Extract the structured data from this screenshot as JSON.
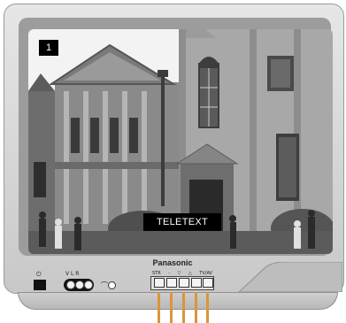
{
  "screen": {
    "channel_number": "1",
    "overlay_text": "TELETEXT"
  },
  "tv": {
    "brand": "Panasonic",
    "av_label": "V   L   R",
    "controls_labels": [
      "STR",
      "-",
      "▽",
      "△",
      "TV/AV"
    ]
  },
  "icons": {
    "power": "power-icon",
    "phones": "headphones-icon"
  }
}
